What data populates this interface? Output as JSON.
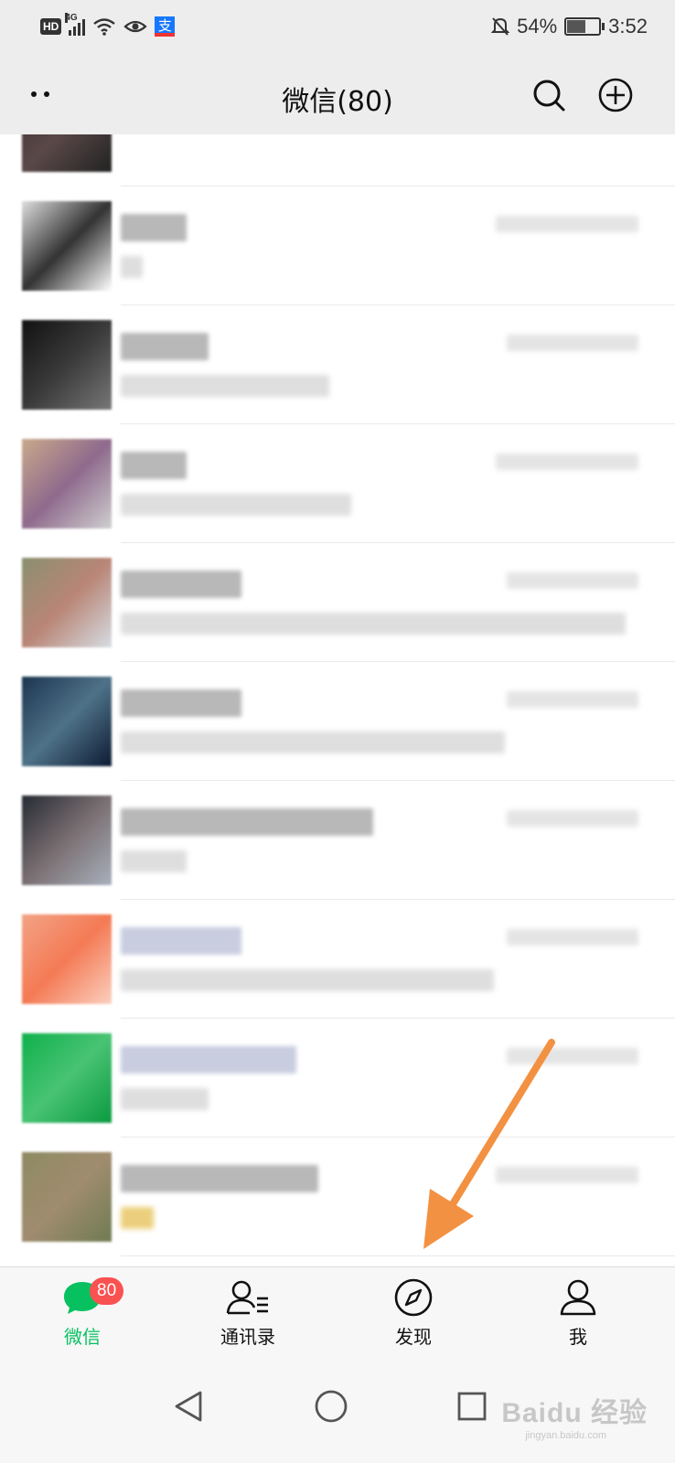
{
  "status_bar": {
    "hd": "HD",
    "network": "4G",
    "alipay": "支",
    "battery": "54%",
    "battery_level": 0.54,
    "time": "3:52"
  },
  "header": {
    "title": "微信(80)",
    "more_icon": "more-dots-icon",
    "search_icon": "search-icon",
    "add_icon": "add-circle-icon"
  },
  "chats": [
    {
      "avatar_colors": [
        "#3b2f2f",
        "#5a4848",
        "#222222"
      ]
    },
    {
      "avatar_colors": [
        "#dddddd",
        "#333333",
        "#ffffff"
      ]
    },
    {
      "avatar_colors": [
        "#111111",
        "#3a3a3a",
        "#777777"
      ]
    },
    {
      "avatar_colors": [
        "#c9a98a",
        "#8f6a8d",
        "#cfcfcf"
      ]
    },
    {
      "avatar_colors": [
        "#8a8f70",
        "#b98576",
        "#d6dde3"
      ]
    },
    {
      "avatar_colors": [
        "#1d3550",
        "#4e7288",
        "#0d1b33"
      ]
    },
    {
      "avatar_colors": [
        "#262b33",
        "#7a6f72",
        "#a8b0bc"
      ]
    },
    {
      "avatar_colors": [
        "#f2a385",
        "#f47a55",
        "#fbd0bf"
      ]
    },
    {
      "avatar_colors": [
        "#10b04c",
        "#48c373",
        "#0a9a40"
      ]
    },
    {
      "avatar_colors": [
        "#8d8a62",
        "#a08c6f",
        "#6f7b52"
      ]
    }
  ],
  "tabs": [
    {
      "label": "微信",
      "icon": "chat-bubble-icon",
      "badge": "80",
      "active": true
    },
    {
      "label": "通讯录",
      "icon": "contacts-icon"
    },
    {
      "label": "发现",
      "icon": "compass-icon"
    },
    {
      "label": "我",
      "icon": "profile-icon"
    }
  ],
  "nav": {
    "back_icon": "back-triangle-icon",
    "home_icon": "home-circle-icon",
    "recent_icon": "recent-square-icon"
  },
  "watermark": {
    "text": "Baidu 经验",
    "sub": "jingyan.baidu.com"
  },
  "colors": {
    "accent": "#07c160",
    "badge": "#fa5151",
    "arrow": "#f39142"
  }
}
